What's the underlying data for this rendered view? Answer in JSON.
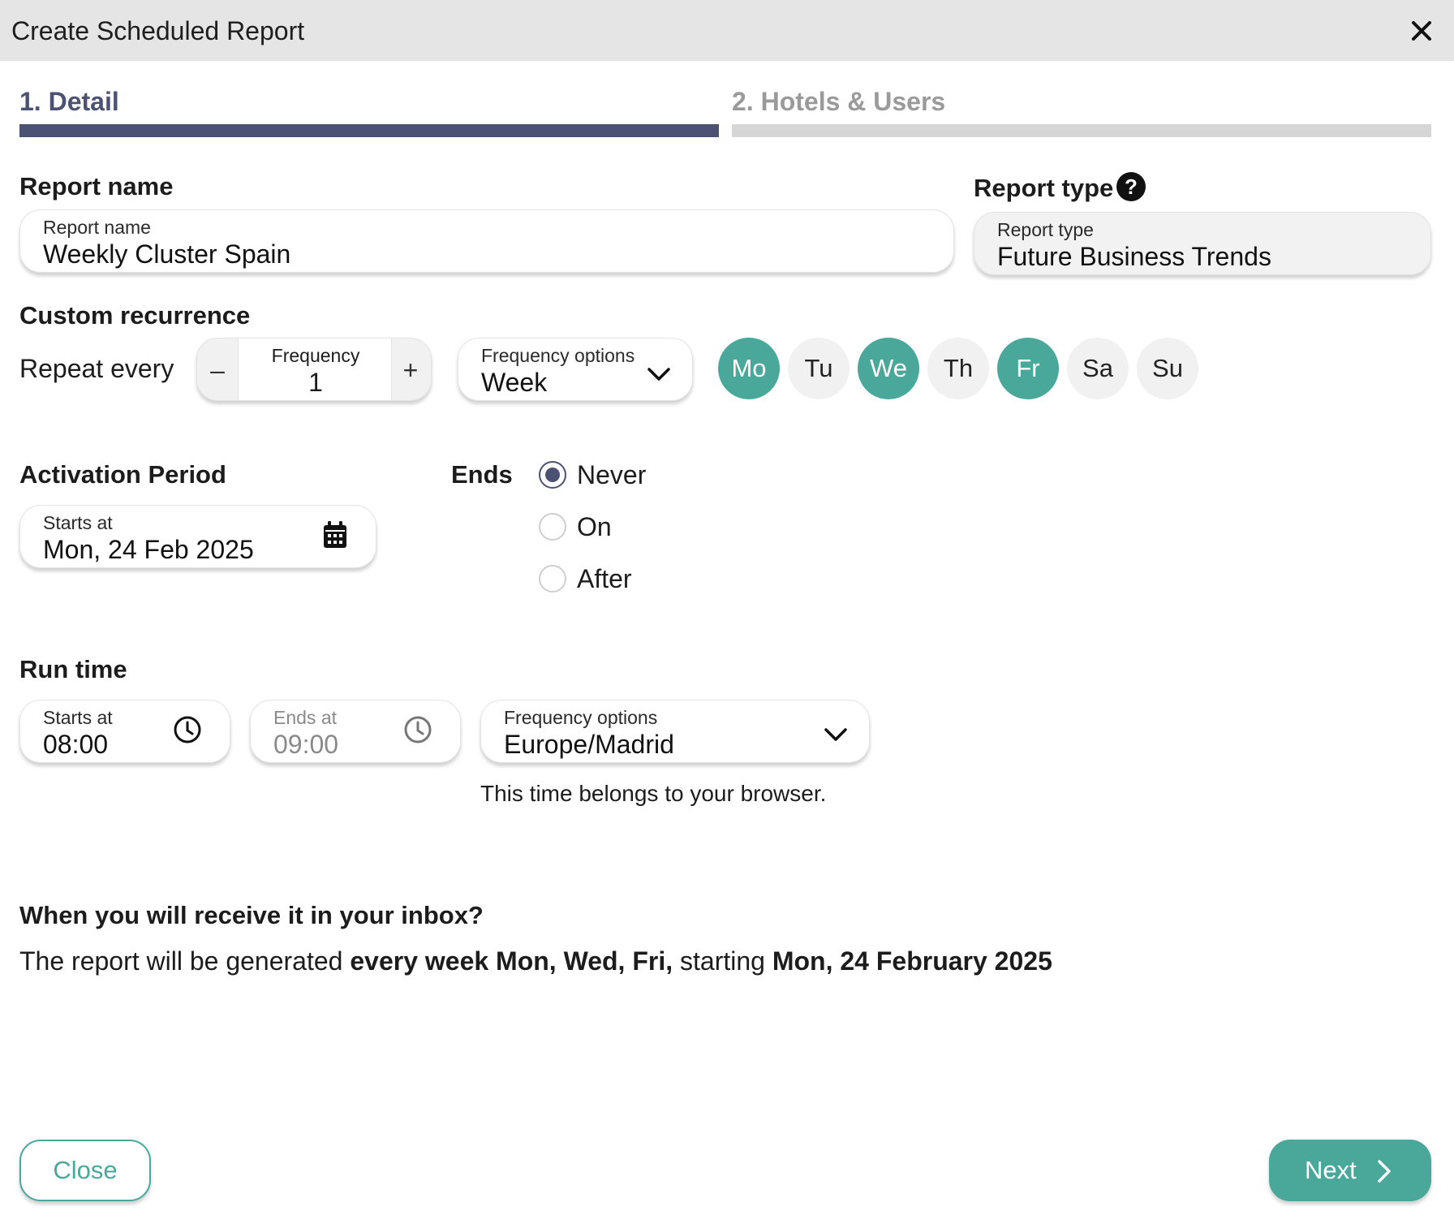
{
  "dialog": {
    "title": "Create Scheduled Report"
  },
  "steps": [
    {
      "label": "1. Detail",
      "active": true
    },
    {
      "label": "2. Hotels & Users",
      "active": false
    }
  ],
  "report_name": {
    "section_label": "Report name",
    "field_label": "Report name",
    "value": "Weekly Cluster Spain"
  },
  "report_type": {
    "section_label": "Report type",
    "help_icon": "question-circle-icon",
    "field_label": "Report type",
    "value": "Future Business Trends"
  },
  "recurrence": {
    "section_label": "Custom recurrence",
    "repeat_label": "Repeat every",
    "minus": "–",
    "plus": "+",
    "frequency_label": "Frequency",
    "frequency_value": "1",
    "options_label": "Frequency options",
    "options_value": "Week",
    "days": [
      {
        "label": "Mo",
        "selected": true
      },
      {
        "label": "Tu",
        "selected": false
      },
      {
        "label": "We",
        "selected": true
      },
      {
        "label": "Th",
        "selected": false
      },
      {
        "label": "Fr",
        "selected": true
      },
      {
        "label": "Sa",
        "selected": false
      },
      {
        "label": "Su",
        "selected": false
      }
    ]
  },
  "activation": {
    "section_label": "Activation Period",
    "start_label": "Starts at",
    "start_value": "Mon, 24 Feb 2025",
    "ends_label": "Ends",
    "ends_options": [
      {
        "label": "Never",
        "checked": true
      },
      {
        "label": "On",
        "checked": false
      },
      {
        "label": "After",
        "checked": false
      }
    ]
  },
  "run_time": {
    "section_label": "Run time",
    "start_label": "Starts at",
    "start_value": "08:00",
    "end_label": "Ends at",
    "end_value": "09:00",
    "timezone_label": "Frequency options",
    "timezone_value": "Europe/Madrid",
    "note": "This time belongs to your browser."
  },
  "summary": {
    "question": "When you will receive it in your inbox?",
    "prefix": "The report will be generated ",
    "schedule": "every week Mon, Wed, Fri,",
    "middle": " starting ",
    "start_date": "Mon, 24 February 2025"
  },
  "buttons": {
    "close": "Close",
    "next": "Next"
  },
  "colors": {
    "accent": "#4aa89a",
    "step_active": "#4b5272",
    "step_inactive": "#d6d6d6"
  }
}
